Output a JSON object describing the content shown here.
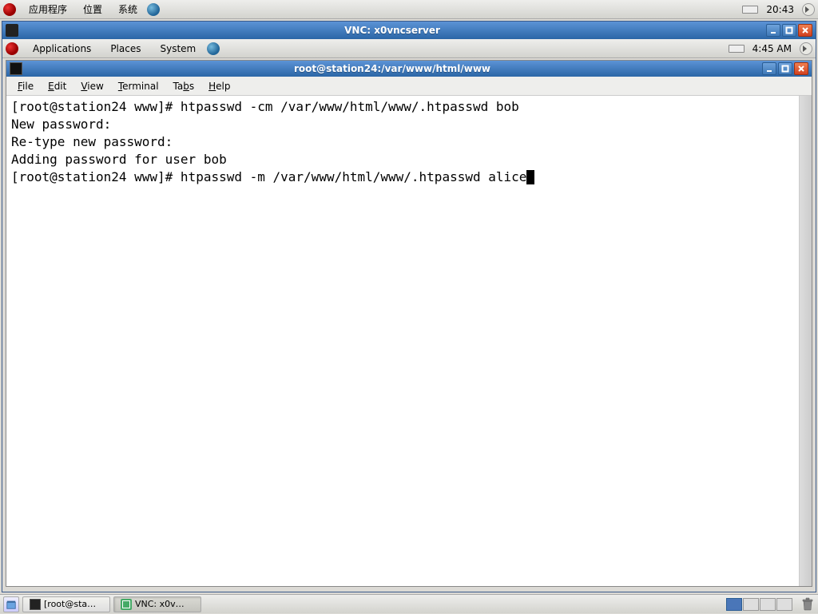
{
  "outer_panel": {
    "apps_label": "应用程序",
    "places_label": "位置",
    "system_label": "系统",
    "clock": "20:43"
  },
  "vnc": {
    "title": "VNC: x0vncserver"
  },
  "inner_panel": {
    "applications": "Applications",
    "places": "Places",
    "system": "System",
    "clock": "4:45 AM"
  },
  "terminal": {
    "title": "root@station24:/var/www/html/www",
    "menu": {
      "file": "File",
      "edit": "Edit",
      "view": "View",
      "terminal": "Terminal",
      "tabs": "Tabs",
      "help": "Help"
    },
    "lines": [
      "[root@station24 www]# htpasswd -cm /var/www/html/www/.htpasswd bob",
      "New password: ",
      "Re-type new password: ",
      "Adding password for user bob",
      "[root@station24 www]# htpasswd -m /var/www/html/www/.htpasswd alice"
    ]
  },
  "taskbar": {
    "item1": "[root@sta…",
    "item2": "VNC: x0v…"
  }
}
